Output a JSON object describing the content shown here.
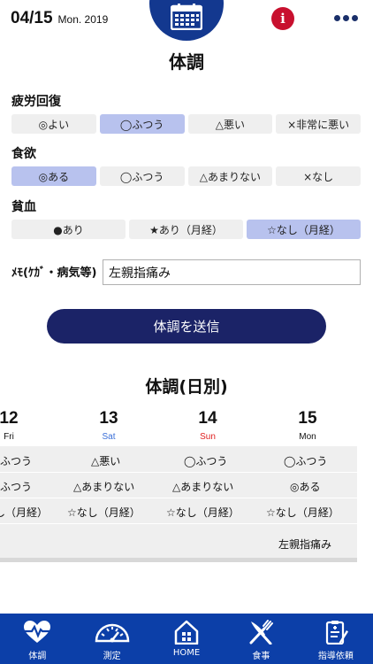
{
  "header": {
    "date": "04/15",
    "weekday_year": "Mon. 2019",
    "calendar_icon": "calendar-icon",
    "info_label": "i",
    "more_icon": "more-dots-icon",
    "accent": "#13388f",
    "info_color": "#c8102e"
  },
  "page_title": "体調",
  "sections": {
    "fatigue": {
      "label": "疲労回復",
      "options": [
        "◎よい",
        "◯ふつう",
        "△悪い",
        "×非常に悪い"
      ],
      "selected": "◯ふつう"
    },
    "appetite": {
      "label": "食欲",
      "options": [
        "◎ある",
        "◯ふつう",
        "△あまりない",
        "×なし"
      ],
      "selected": "◎ある"
    },
    "anemia": {
      "label": "貧血",
      "options": [
        "●あり",
        "★あり（月経）",
        "☆なし（月経）"
      ],
      "selected": "☆なし（月経）"
    }
  },
  "memo": {
    "label": "ﾒﾓ(ｹｶﾞ・病気等)",
    "value": "左親指痛み"
  },
  "send_label": "体調を送信",
  "daily": {
    "title": "体調(日別)",
    "days": [
      {
        "num": "12",
        "dow": "Fri",
        "color": "#111111"
      },
      {
        "num": "13",
        "dow": "Sat",
        "color": "#3a6fd8"
      },
      {
        "num": "14",
        "dow": "Sun",
        "color": "#e02020"
      },
      {
        "num": "15",
        "dow": "Mon",
        "color": "#111111"
      }
    ],
    "rows": [
      [
        "ふつう",
        "△悪い",
        "◯ふつう",
        "◯ふつう"
      ],
      [
        "ふつう",
        "△あまりない",
        "△あまりない",
        "◎ある"
      ],
      [
        "し（月経）",
        "☆なし（月経）",
        "☆なし（月経）",
        "☆なし（月経）"
      ],
      [
        "",
        "",
        "",
        "左親指痛み"
      ]
    ]
  },
  "nav": [
    {
      "label": "体調",
      "icon": "heart-pulse-icon"
    },
    {
      "label": "測定",
      "icon": "gauge-icon"
    },
    {
      "label": "HOME",
      "icon": "home-icon"
    },
    {
      "label": "食事",
      "icon": "utensils-icon"
    },
    {
      "label": "指導依頼",
      "icon": "clipboard-plus-icon"
    }
  ],
  "nav_color": "#0c3fa8",
  "selected_option_color": "#b8c2ee",
  "send_button_color": "#1b2367"
}
